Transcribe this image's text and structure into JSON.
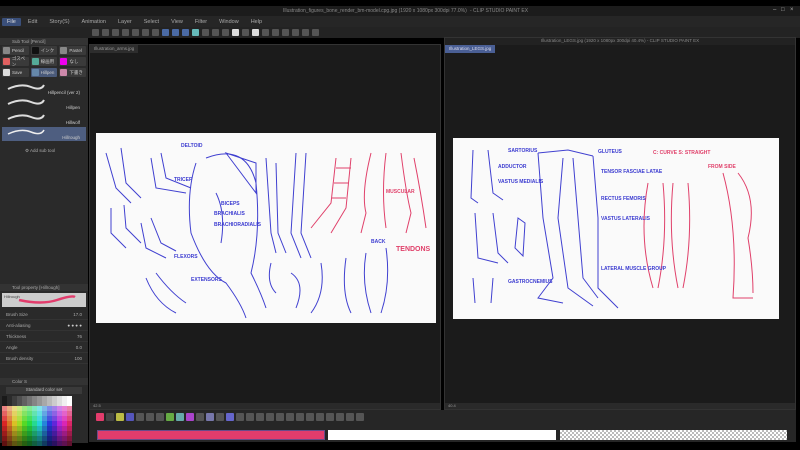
{
  "app": {
    "left_title": "Illustration_figures_bone_render_bm-model.cpg.jpg (1920 x 1080px 300dpi 77.0%)",
    "right_title_tail": "- CLIP STUDIO PAINT EX",
    "right_title": "Illustration_LEGS.jpg (1920 x 1080px 300dpi 40.4%) - CLIP STUDIO PAINT EX"
  },
  "menu": [
    "File",
    "Edit",
    "Story(S)",
    "Animation",
    "Layer",
    "Select",
    "View",
    "Filter",
    "Window",
    "Help"
  ],
  "subtool": {
    "header": "Sub Tool [Pencil]",
    "tabs": [
      {
        "label": "Pencil",
        "color": "#888"
      },
      {
        "label": "インク",
        "color": "#222"
      },
      {
        "label": "Pastel",
        "color": "#888"
      },
      {
        "label": "ゴスペン",
        "color": "#e06060"
      },
      {
        "label": "線画用",
        "color": "#5a9"
      },
      {
        "label": "なし",
        "color": "#e0e"
      },
      {
        "label": "Save",
        "color": "#ddd"
      },
      {
        "label": "Hillpen",
        "color": "#68a"
      },
      {
        "label": "下書き",
        "color": "#c8a"
      }
    ],
    "brushes": [
      "Hillpencil (ver 2)",
      "Hillpen",
      "Hillwolf",
      "Hillrough"
    ],
    "add": "Add sub tool"
  },
  "toolprop": {
    "header": "Tool property [Hillrough]",
    "preview_label": "Hillrough",
    "rows": [
      {
        "label": "Brush Size",
        "value": "17.0"
      },
      {
        "label": "Anti-aliasing",
        "value": ""
      },
      {
        "label": "Thickness",
        "value": "76"
      },
      {
        "label": "Angle",
        "value": "0.0"
      },
      {
        "label": "Brush density",
        "value": "100"
      }
    ]
  },
  "colorset": {
    "tab": "Color S",
    "name": "Standard color set"
  },
  "docs": {
    "left_tab": "Illustration_arms.jpg",
    "right_tab": "Illustration_LEGS.jpg",
    "left_zoom": "42.5",
    "right_zoom": "40.4"
  },
  "colors": {
    "main": "#e23c6c",
    "sub": "#ffffff",
    "accent": "#4a5f95"
  },
  "art": {
    "left_labels": [
      "DELTOID",
      "TRICEP",
      "BICEPS",
      "BRACHIALIS",
      "BRACHIORADIALIS",
      "FLEXORS",
      "EXTENSORS",
      "BACK",
      "MUSCULAR",
      "TENDONS"
    ],
    "right_labels": [
      "SARTORIUS",
      "ADDUCTOR",
      "VASTUS MEDIALIS",
      "GLUTEUS",
      "TENSOR FASCIAE LATAE",
      "RECTUS FEMORIS",
      "VASTUS LATERALIS",
      "GASTROCNEMIUS",
      "LATERAL MUSCLE GROUP",
      "C: CURVE   S: STRAIGHT",
      "FROM SIDE"
    ]
  }
}
